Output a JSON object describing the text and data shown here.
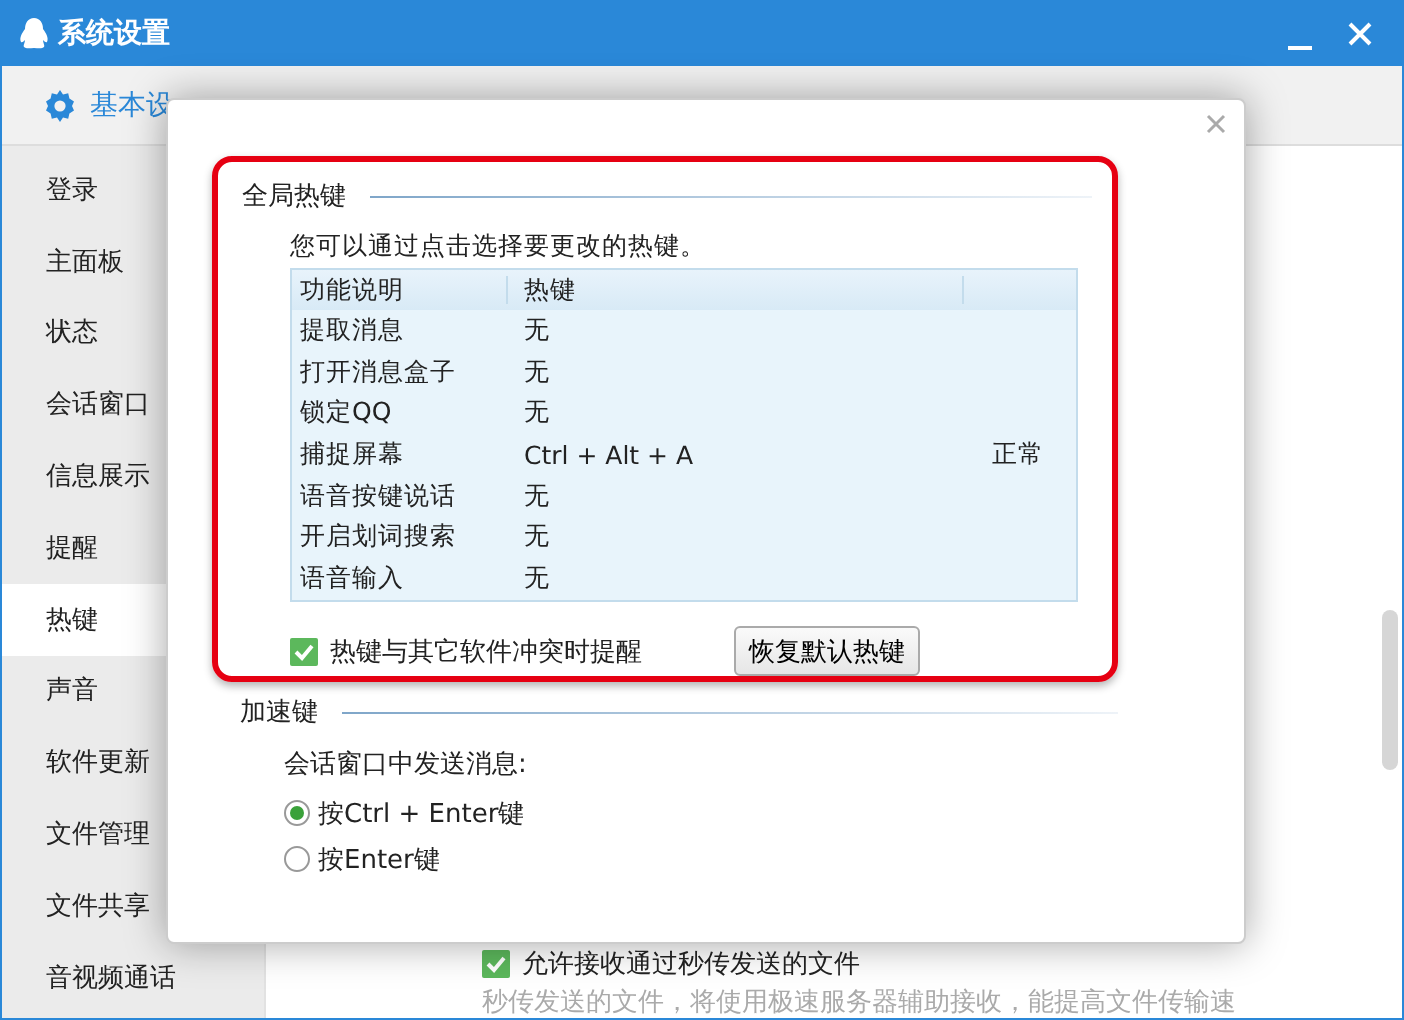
{
  "window": {
    "title": "系统设置"
  },
  "toolbar": {
    "tabs": [
      {
        "label": "基本设",
        "selected": true
      }
    ]
  },
  "sidebar": {
    "items": [
      {
        "label": "登录",
        "selected": false
      },
      {
        "label": "主面板",
        "selected": false
      },
      {
        "label": "状态",
        "selected": false
      },
      {
        "label": "会话窗口",
        "selected": false
      },
      {
        "label": "信息展示",
        "selected": false
      },
      {
        "label": "提醒",
        "selected": false
      },
      {
        "label": "热键",
        "selected": true
      },
      {
        "label": "声音",
        "selected": false
      },
      {
        "label": "软件更新",
        "selected": false
      },
      {
        "label": "文件管理",
        "selected": false
      },
      {
        "label": "文件共享",
        "selected": false
      },
      {
        "label": "音视频通话",
        "selected": false
      }
    ]
  },
  "background_content": {
    "checkbox": {
      "label": "允许接收通过秒传发送的文件",
      "checked": true
    },
    "note": "秒传发送的文件，将使用极速服务器辅助接收，能提高文件传输速"
  },
  "dialog": {
    "hotkeys": {
      "title": "全局热键",
      "hint": "您可以通过点击选择要更改的热键。",
      "columns": [
        "功能说明",
        "热键"
      ],
      "rows": [
        {
          "function": "提取消息",
          "hotkey": "无"
        },
        {
          "function": "打开消息盒子",
          "hotkey": "无"
        },
        {
          "function": "锁定QQ",
          "hotkey": "无"
        },
        {
          "function": "捕捉屏幕",
          "hotkey": "Ctrl + Alt + A",
          "status": "正常"
        },
        {
          "function": "语音按键说话",
          "hotkey": "无"
        },
        {
          "function": "开启划词搜索",
          "hotkey": "无"
        },
        {
          "function": "语音输入",
          "hotkey": "无"
        }
      ],
      "conflict_alert": {
        "label": "热键与其它软件冲突时提醒",
        "checked": true
      },
      "restore_button": "恢复默认热键"
    },
    "accelerator": {
      "title": "加速键",
      "prompt": "会话窗口中发送消息:",
      "options": [
        {
          "label": "按Ctrl + Enter键",
          "selected": true
        },
        {
          "label": "按Enter键",
          "selected": false
        }
      ]
    }
  }
}
